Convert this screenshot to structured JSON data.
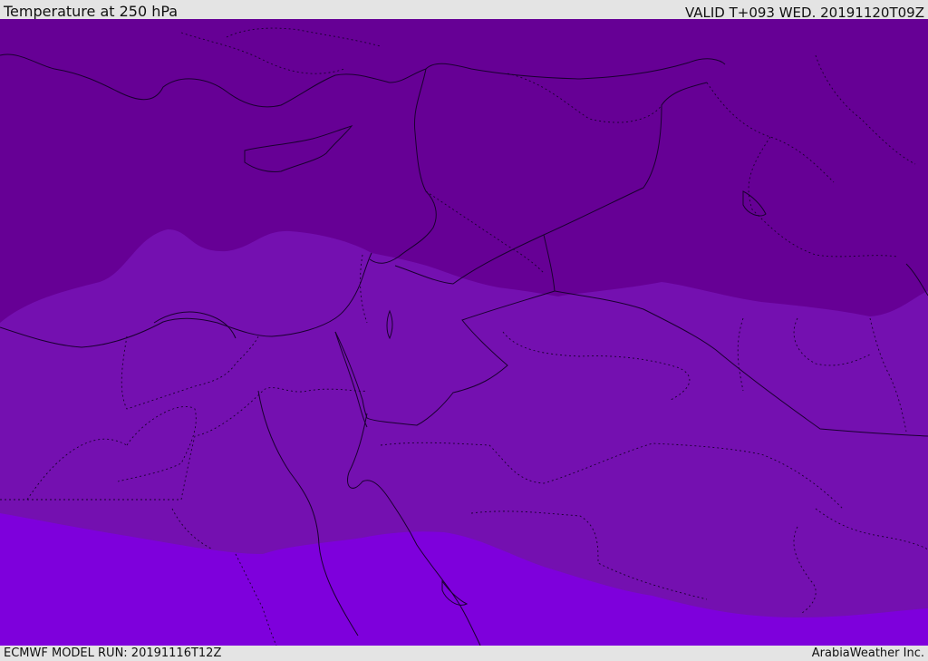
{
  "header": {
    "title": "Temperature at 250 hPa",
    "valid": "VALID T+093 WED. 20191120T09Z"
  },
  "footer": {
    "model_run": "ECMWF MODEL RUN: 20191116T12Z",
    "credit": "ArabiaWeather Inc."
  },
  "map": {
    "colors": {
      "band_coldest": "#660095",
      "band_mid": "#7410b0",
      "band_warm": "#7e00dc",
      "coast": "#1a0030",
      "border": "#1a0030"
    }
  }
}
